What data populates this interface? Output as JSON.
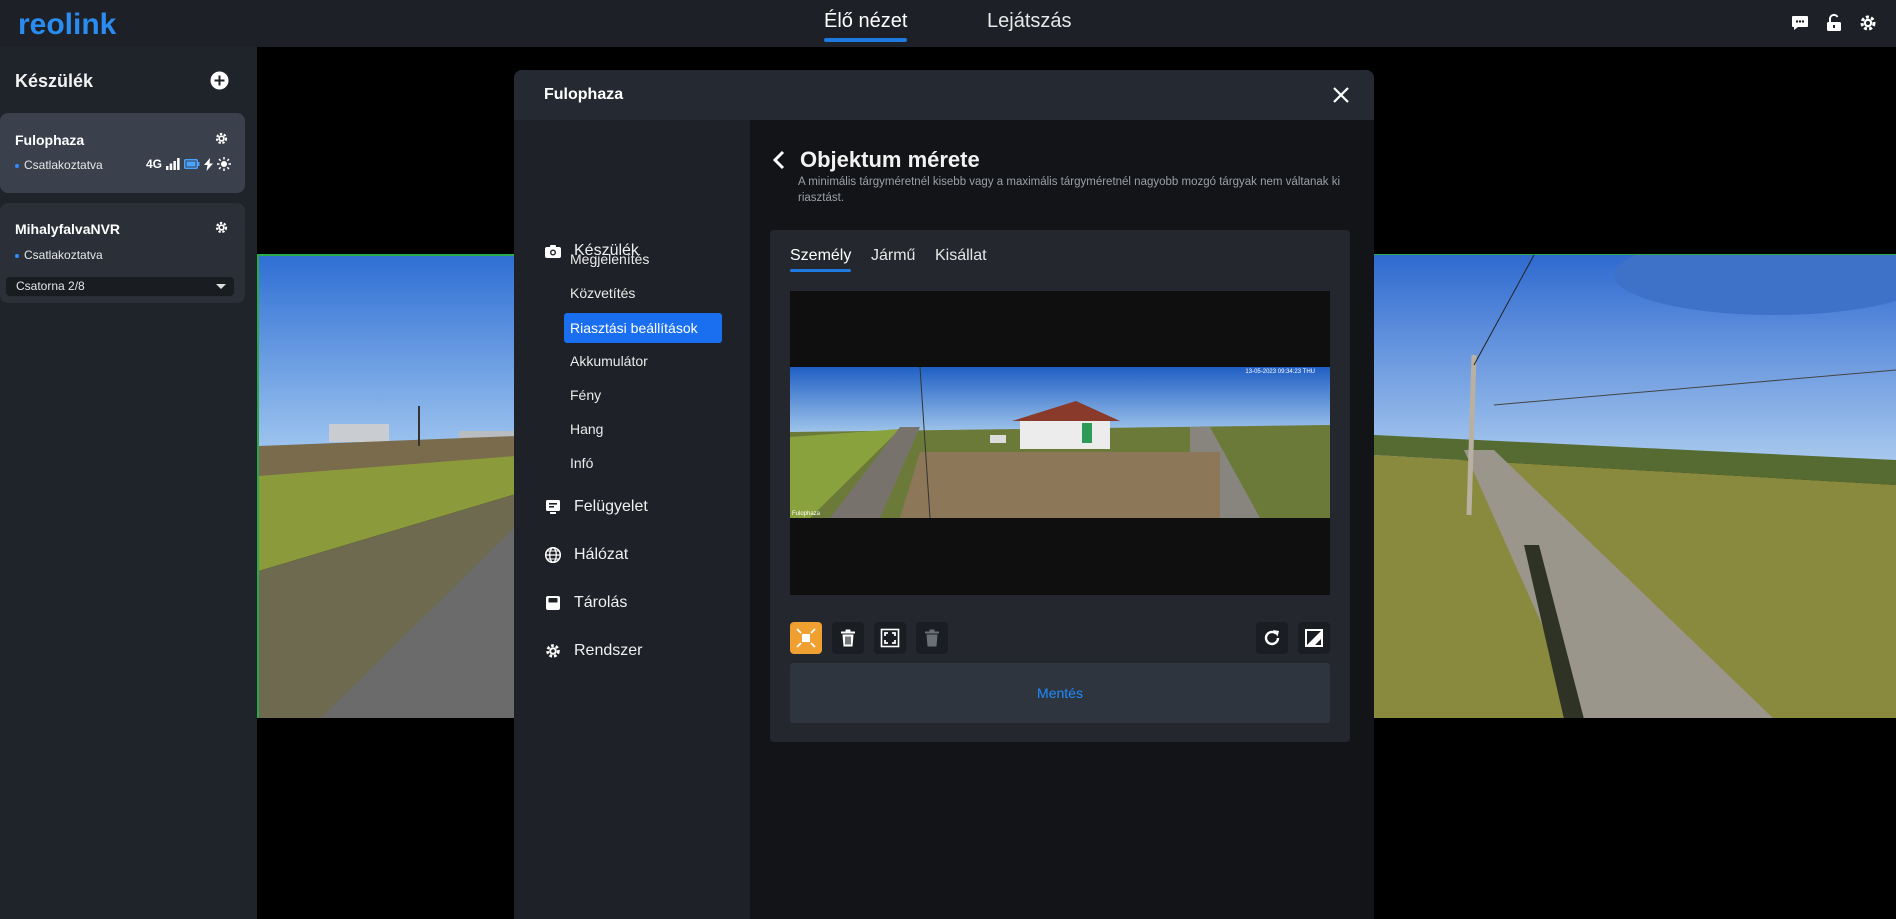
{
  "app": {
    "brand": "reolink",
    "colors": {
      "accent": "#1f7ae0",
      "brand": "#2a8cf0",
      "selected_tool": "#f0a030"
    }
  },
  "topnav": {
    "tabs": [
      {
        "label": "Élő nézet",
        "active": true
      },
      {
        "label": "Lejátszás",
        "active": false
      }
    ],
    "icons": [
      "chat-icon",
      "unlock-icon",
      "gear-icon"
    ]
  },
  "sidebar": {
    "title": "Készülék",
    "devices": [
      {
        "name": "Fulophaza",
        "status": "Csatlakoztatva",
        "network": "4G",
        "active": true
      },
      {
        "name": "MihalyfalvaNVR",
        "status": "Csatlakoztatva",
        "channel": "Csatorna 2/8",
        "active": false
      }
    ]
  },
  "modal": {
    "title": "Fulophaza",
    "nav": {
      "sections": [
        {
          "label": "Készülék",
          "icon": "camera-icon"
        },
        {
          "label": "Felügyelet",
          "icon": "monitor-icon"
        },
        {
          "label": "Hálózat",
          "icon": "globe-icon"
        },
        {
          "label": "Tárolás",
          "icon": "storage-icon"
        },
        {
          "label": "Rendszer",
          "icon": "gear-icon"
        }
      ],
      "device_items": [
        "Megjelenítés",
        "Közvetítés",
        "Riasztási beállítások",
        "Akkumulátor",
        "Fény",
        "Hang",
        "Infó"
      ],
      "active_item": "Riasztási beállítások"
    },
    "content": {
      "title": "Objektum mérete",
      "description": "A minimális tárgyméretnél kisebb vagy a maximális tárgyméretnél nagyobb mozgó tárgyak nem váltanak ki riasztást.",
      "tabs": [
        "Személy",
        "Jármű",
        "Kisállat"
      ],
      "active_tab": "Személy",
      "preview": {
        "timestamp": "13-05-2023 09:34:23 THU",
        "camera_label": "Fulophaza"
      },
      "save_label": "Mentés"
    }
  }
}
